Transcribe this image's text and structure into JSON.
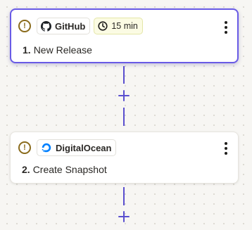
{
  "colors": {
    "accent": "#695be6",
    "connector": "#5a4fcf",
    "warning": "#8a6b1c",
    "delay_bg": "#fbfbe3"
  },
  "steps": [
    {
      "number": "1.",
      "title": "New Release",
      "app": {
        "name": "GitHub",
        "icon": "github-icon"
      },
      "delay": {
        "label": "15 min",
        "icon": "clock-icon"
      },
      "warning_icon": "warning-icon",
      "selected": true
    },
    {
      "number": "2.",
      "title": "Create Snapshot",
      "app": {
        "name": "DigitalOcean",
        "icon": "digitalocean-icon"
      },
      "warning_icon": "warning-icon",
      "selected": false
    }
  ],
  "add_step_icon": "plus-icon",
  "menu_icon": "more-vertical-icon"
}
